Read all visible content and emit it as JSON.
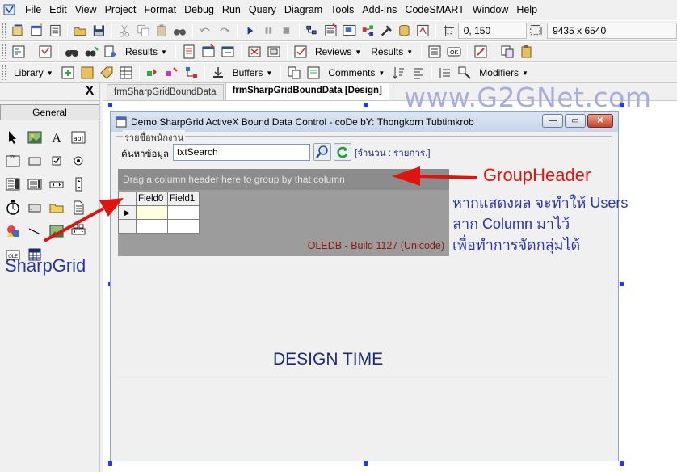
{
  "menu": {
    "items": [
      "File",
      "Edit",
      "View",
      "Project",
      "Format",
      "Debug",
      "Run",
      "Query",
      "Diagram",
      "Tools",
      "Add-Ins",
      "CodeSMART",
      "Window",
      "Help"
    ]
  },
  "toolbar1": {
    "position": "0, 150",
    "size": "9435 x 6540"
  },
  "toolbar2": {
    "results_label": "Results",
    "reviews_label": "Reviews",
    "results2_label": "Results"
  },
  "toolbar3": {
    "library_label": "Library",
    "buffers_label": "Buffers",
    "comments_label": "Comments",
    "modifiers_label": "Modifiers"
  },
  "toolbox": {
    "close": "X",
    "tab": "General"
  },
  "doc_tabs": [
    "frmSharpGridBoundData",
    "frmSharpGridBoundData [Design]"
  ],
  "watermark": "www.G2GNet.com",
  "form": {
    "title": "Demo SharpGrid ActiveX Bound Data Control  - coDe bY: Thongkorn Tubtimkrob",
    "group_label": "รายชื่อพนักงาน",
    "search_label": "ค้นหาข้อมูล",
    "search_value": "txtSearch",
    "count_label": "[จำนวน : รายการ.]",
    "group_header": "Drag a column header here to group by that column",
    "columns": [
      "Field0",
      "Field1"
    ],
    "build": "OLEDB - Build 1127 (Unicode)",
    "design_time": "DESIGN TIME"
  },
  "annotations": {
    "groupheader": "GroupHeader",
    "thai_lines": [
      "หากแสดงผล จะทำให้ Users",
      "ลาก Column มาไว้",
      "เพื่อทำการจัดกลุ่มได้"
    ],
    "sharpgrid": "SharpGrid"
  },
  "colors": {
    "annotation_red": "#e0140e",
    "annotation_blue": "#2d34a8",
    "watermark": "#a9aed8"
  }
}
